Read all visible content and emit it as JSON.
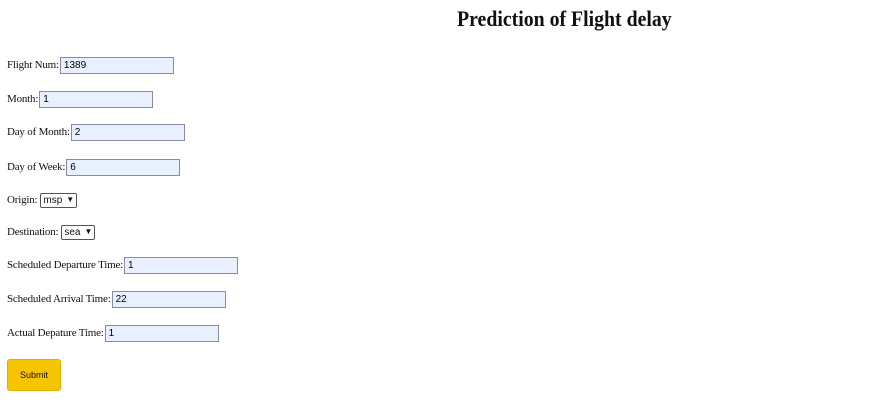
{
  "header": {
    "title": "Prediction of Flight delay"
  },
  "form": {
    "flight_num": {
      "label": "Flight Num:",
      "value": "1389"
    },
    "month": {
      "label": "Month:",
      "value": "1"
    },
    "day_of_month": {
      "label": "Day of Month:",
      "value": "2"
    },
    "day_of_week": {
      "label": "Day of Week:",
      "value": "6"
    },
    "origin": {
      "label": "Origin:",
      "selected": "msp"
    },
    "destination": {
      "label": "Destination:",
      "selected": "sea"
    },
    "sched_dep": {
      "label": "Scheduled Departure Time:",
      "value": "1"
    },
    "sched_arr": {
      "label": "Scheduled Arrival Time:",
      "value": "22"
    },
    "actual_dep": {
      "label": "Actual Depature Time:",
      "value": "1"
    },
    "submit_label": "Submit"
  },
  "icons": {
    "select_arrow": "chevron-down-icon"
  },
  "colors": {
    "submit_bg": "#f6c400",
    "input_bg": "#e8f0fe"
  }
}
